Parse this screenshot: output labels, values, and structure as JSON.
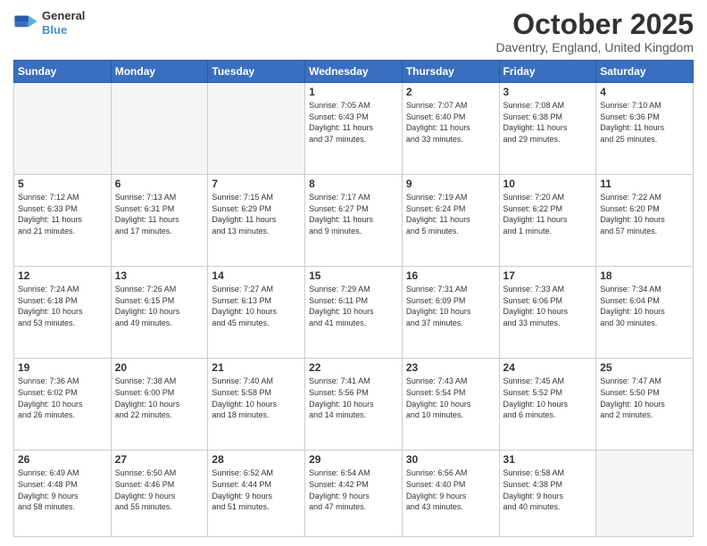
{
  "header": {
    "logo_line1": "General",
    "logo_line2": "Blue",
    "month_title": "October 2025",
    "location": "Daventry, England, United Kingdom"
  },
  "weekdays": [
    "Sunday",
    "Monday",
    "Tuesday",
    "Wednesday",
    "Thursday",
    "Friday",
    "Saturday"
  ],
  "rows": [
    [
      {
        "day": "",
        "info": ""
      },
      {
        "day": "",
        "info": ""
      },
      {
        "day": "",
        "info": ""
      },
      {
        "day": "1",
        "info": "Sunrise: 7:05 AM\nSunset: 6:43 PM\nDaylight: 11 hours\nand 37 minutes."
      },
      {
        "day": "2",
        "info": "Sunrise: 7:07 AM\nSunset: 6:40 PM\nDaylight: 11 hours\nand 33 minutes."
      },
      {
        "day": "3",
        "info": "Sunrise: 7:08 AM\nSunset: 6:38 PM\nDaylight: 11 hours\nand 29 minutes."
      },
      {
        "day": "4",
        "info": "Sunrise: 7:10 AM\nSunset: 6:36 PM\nDaylight: 11 hours\nand 25 minutes."
      }
    ],
    [
      {
        "day": "5",
        "info": "Sunrise: 7:12 AM\nSunset: 6:33 PM\nDaylight: 11 hours\nand 21 minutes."
      },
      {
        "day": "6",
        "info": "Sunrise: 7:13 AM\nSunset: 6:31 PM\nDaylight: 11 hours\nand 17 minutes."
      },
      {
        "day": "7",
        "info": "Sunrise: 7:15 AM\nSunset: 6:29 PM\nDaylight: 11 hours\nand 13 minutes."
      },
      {
        "day": "8",
        "info": "Sunrise: 7:17 AM\nSunset: 6:27 PM\nDaylight: 11 hours\nand 9 minutes."
      },
      {
        "day": "9",
        "info": "Sunrise: 7:19 AM\nSunset: 6:24 PM\nDaylight: 11 hours\nand 5 minutes."
      },
      {
        "day": "10",
        "info": "Sunrise: 7:20 AM\nSunset: 6:22 PM\nDaylight: 11 hours\nand 1 minute."
      },
      {
        "day": "11",
        "info": "Sunrise: 7:22 AM\nSunset: 6:20 PM\nDaylight: 10 hours\nand 57 minutes."
      }
    ],
    [
      {
        "day": "12",
        "info": "Sunrise: 7:24 AM\nSunset: 6:18 PM\nDaylight: 10 hours\nand 53 minutes."
      },
      {
        "day": "13",
        "info": "Sunrise: 7:26 AM\nSunset: 6:15 PM\nDaylight: 10 hours\nand 49 minutes."
      },
      {
        "day": "14",
        "info": "Sunrise: 7:27 AM\nSunset: 6:13 PM\nDaylight: 10 hours\nand 45 minutes."
      },
      {
        "day": "15",
        "info": "Sunrise: 7:29 AM\nSunset: 6:11 PM\nDaylight: 10 hours\nand 41 minutes."
      },
      {
        "day": "16",
        "info": "Sunrise: 7:31 AM\nSunset: 6:09 PM\nDaylight: 10 hours\nand 37 minutes."
      },
      {
        "day": "17",
        "info": "Sunrise: 7:33 AM\nSunset: 6:06 PM\nDaylight: 10 hours\nand 33 minutes."
      },
      {
        "day": "18",
        "info": "Sunrise: 7:34 AM\nSunset: 6:04 PM\nDaylight: 10 hours\nand 30 minutes."
      }
    ],
    [
      {
        "day": "19",
        "info": "Sunrise: 7:36 AM\nSunset: 6:02 PM\nDaylight: 10 hours\nand 26 minutes."
      },
      {
        "day": "20",
        "info": "Sunrise: 7:38 AM\nSunset: 6:00 PM\nDaylight: 10 hours\nand 22 minutes."
      },
      {
        "day": "21",
        "info": "Sunrise: 7:40 AM\nSunset: 5:58 PM\nDaylight: 10 hours\nand 18 minutes."
      },
      {
        "day": "22",
        "info": "Sunrise: 7:41 AM\nSunset: 5:56 PM\nDaylight: 10 hours\nand 14 minutes."
      },
      {
        "day": "23",
        "info": "Sunrise: 7:43 AM\nSunset: 5:54 PM\nDaylight: 10 hours\nand 10 minutes."
      },
      {
        "day": "24",
        "info": "Sunrise: 7:45 AM\nSunset: 5:52 PM\nDaylight: 10 hours\nand 6 minutes."
      },
      {
        "day": "25",
        "info": "Sunrise: 7:47 AM\nSunset: 5:50 PM\nDaylight: 10 hours\nand 2 minutes."
      }
    ],
    [
      {
        "day": "26",
        "info": "Sunrise: 6:49 AM\nSunset: 4:48 PM\nDaylight: 9 hours\nand 58 minutes."
      },
      {
        "day": "27",
        "info": "Sunrise: 6:50 AM\nSunset: 4:46 PM\nDaylight: 9 hours\nand 55 minutes."
      },
      {
        "day": "28",
        "info": "Sunrise: 6:52 AM\nSunset: 4:44 PM\nDaylight: 9 hours\nand 51 minutes."
      },
      {
        "day": "29",
        "info": "Sunrise: 6:54 AM\nSunset: 4:42 PM\nDaylight: 9 hours\nand 47 minutes."
      },
      {
        "day": "30",
        "info": "Sunrise: 6:56 AM\nSunset: 4:40 PM\nDaylight: 9 hours\nand 43 minutes."
      },
      {
        "day": "31",
        "info": "Sunrise: 6:58 AM\nSunset: 4:38 PM\nDaylight: 9 hours\nand 40 minutes."
      },
      {
        "day": "",
        "info": ""
      }
    ]
  ]
}
